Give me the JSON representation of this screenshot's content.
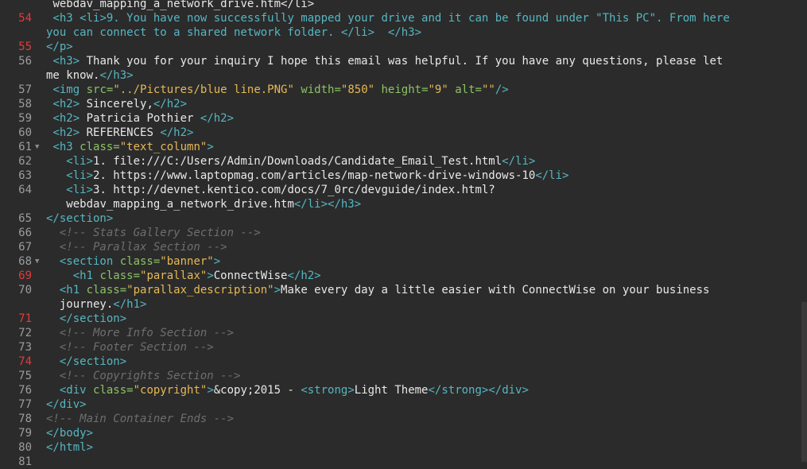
{
  "editor": {
    "lines": [
      {
        "num": "",
        "indent": 1,
        "fold": false,
        "err": false,
        "tokens": [
          {
            "t": "text",
            "v": "webdav_mapping_a_network_drive.htm</li>"
          }
        ]
      },
      {
        "num": "54",
        "indent": 1,
        "fold": false,
        "err": true,
        "tokens": [
          {
            "t": "tag",
            "v": "<h3 <li>"
          },
          {
            "t": "tag",
            "v": "9. You have now successfully mapped your drive and it can be found under \"This PC\". From here"
          }
        ]
      },
      {
        "num": "",
        "indent": 0,
        "fold": false,
        "err": false,
        "tokens": [
          {
            "t": "tag",
            "v": "you can connect to a shared network folder. </li>  </h3>"
          }
        ]
      },
      {
        "num": "55",
        "indent": 0,
        "fold": false,
        "err": true,
        "tokens": [
          {
            "t": "tag",
            "v": "</p>"
          }
        ]
      },
      {
        "num": "56",
        "indent": 1,
        "fold": false,
        "err": false,
        "tokens": [
          {
            "t": "tag",
            "v": "<h3>"
          },
          {
            "t": "text",
            "v": " Thank you for your inquiry I hope this email was helpful. If you have any questions, please let"
          }
        ]
      },
      {
        "num": "",
        "indent": 0,
        "fold": false,
        "err": false,
        "tokens": [
          {
            "t": "text",
            "v": "me know."
          },
          {
            "t": "tag",
            "v": "</h3>"
          }
        ]
      },
      {
        "num": "57",
        "indent": 1,
        "fold": false,
        "err": false,
        "tokens": [
          {
            "t": "tag",
            "v": "<img "
          },
          {
            "t": "attr",
            "v": "src="
          },
          {
            "t": "val",
            "v": "\"../Pictures/blue line.PNG\""
          },
          {
            "t": "attr",
            "v": " width="
          },
          {
            "t": "val",
            "v": "\"850\""
          },
          {
            "t": "attr",
            "v": " height="
          },
          {
            "t": "val",
            "v": "\"9\""
          },
          {
            "t": "attr",
            "v": " alt="
          },
          {
            "t": "val",
            "v": "\"\""
          },
          {
            "t": "tag",
            "v": "/>"
          }
        ]
      },
      {
        "num": "58",
        "indent": 1,
        "fold": false,
        "err": false,
        "tokens": [
          {
            "t": "tag",
            "v": "<h2>"
          },
          {
            "t": "text",
            "v": " Sincerely,"
          },
          {
            "t": "tag",
            "v": "</h2>"
          }
        ]
      },
      {
        "num": "59",
        "indent": 1,
        "fold": false,
        "err": false,
        "tokens": [
          {
            "t": "tag",
            "v": "<h2>"
          },
          {
            "t": "text",
            "v": " Patricia Pothier "
          },
          {
            "t": "tag",
            "v": "</h2>"
          }
        ]
      },
      {
        "num": "60",
        "indent": 1,
        "fold": false,
        "err": false,
        "tokens": [
          {
            "t": "tag",
            "v": "<h2>"
          },
          {
            "t": "text",
            "v": " REFERENCES "
          },
          {
            "t": "tag",
            "v": "</h2>"
          }
        ]
      },
      {
        "num": "61",
        "indent": 1,
        "fold": true,
        "err": false,
        "tokens": [
          {
            "t": "tag",
            "v": "<h3 "
          },
          {
            "t": "attr",
            "v": "class="
          },
          {
            "t": "val",
            "v": "\"text_column\""
          },
          {
            "t": "tag",
            "v": ">"
          }
        ]
      },
      {
        "num": "62",
        "indent": 3,
        "fold": false,
        "err": false,
        "tokens": [
          {
            "t": "tag",
            "v": "<li>"
          },
          {
            "t": "text",
            "v": "1. file:///C:/Users/Admin/Downloads/Candidate_Email_Test.html"
          },
          {
            "t": "tag",
            "v": "</li>"
          }
        ]
      },
      {
        "num": "63",
        "indent": 3,
        "fold": false,
        "err": false,
        "tokens": [
          {
            "t": "tag",
            "v": "<li>"
          },
          {
            "t": "text",
            "v": "2. https://www.laptopmag.com/articles/map-network-drive-windows-10"
          },
          {
            "t": "tag",
            "v": "</li>"
          }
        ]
      },
      {
        "num": "64",
        "indent": 3,
        "fold": false,
        "err": false,
        "tokens": [
          {
            "t": "tag",
            "v": "<li>"
          },
          {
            "t": "text",
            "v": "3. http://devnet.kentico.com/docs/7_0rc/devguide/index.html?"
          }
        ]
      },
      {
        "num": "",
        "indent": 3,
        "fold": false,
        "err": false,
        "tokens": [
          {
            "t": "text",
            "v": "webdav_mapping_a_network_drive.htm"
          },
          {
            "t": "tag",
            "v": "</li></h3>"
          }
        ]
      },
      {
        "num": "65",
        "indent": 0,
        "fold": false,
        "err": false,
        "tokens": [
          {
            "t": "tag",
            "v": "</section>"
          }
        ]
      },
      {
        "num": "66",
        "indent": 2,
        "fold": false,
        "err": false,
        "tokens": [
          {
            "t": "com",
            "v": "<!-- Stats Gallery Section -->"
          }
        ]
      },
      {
        "num": "67",
        "indent": 2,
        "fold": false,
        "err": false,
        "tokens": [
          {
            "t": "com",
            "v": "<!-- Parallax Section -->"
          }
        ]
      },
      {
        "num": "68",
        "indent": 2,
        "fold": true,
        "err": false,
        "tokens": [
          {
            "t": "tag",
            "v": "<section "
          },
          {
            "t": "attr",
            "v": "class="
          },
          {
            "t": "val",
            "v": "\"banner\""
          },
          {
            "t": "tag",
            "v": ">"
          }
        ]
      },
      {
        "num": "69",
        "indent": 4,
        "fold": false,
        "err": true,
        "tokens": [
          {
            "t": "tag",
            "v": "<h1 "
          },
          {
            "t": "attr",
            "v": "class="
          },
          {
            "t": "val",
            "v": "\"parallax\""
          },
          {
            "t": "tag",
            "v": ">"
          },
          {
            "t": "text",
            "v": "ConnectWise"
          },
          {
            "t": "tag",
            "v": "</h2>"
          }
        ]
      },
      {
        "num": "70",
        "indent": 2,
        "fold": false,
        "err": false,
        "tokens": [
          {
            "t": "tag",
            "v": "<h1 "
          },
          {
            "t": "attr",
            "v": "class="
          },
          {
            "t": "val",
            "v": "\"parallax_description\""
          },
          {
            "t": "tag",
            "v": ">"
          },
          {
            "t": "text",
            "v": "Make every day a little easier with ConnectWise on your business"
          }
        ]
      },
      {
        "num": "",
        "indent": 2,
        "fold": false,
        "err": false,
        "tokens": [
          {
            "t": "text",
            "v": "journey."
          },
          {
            "t": "tag",
            "v": "</h1>"
          }
        ]
      },
      {
        "num": "71",
        "indent": 2,
        "fold": false,
        "err": true,
        "tokens": [
          {
            "t": "tag",
            "v": "</section>"
          }
        ]
      },
      {
        "num": "72",
        "indent": 2,
        "fold": false,
        "err": false,
        "tokens": [
          {
            "t": "com",
            "v": "<!-- More Info Section -->"
          }
        ]
      },
      {
        "num": "73",
        "indent": 2,
        "fold": false,
        "err": false,
        "tokens": [
          {
            "t": "com",
            "v": "<!-- Footer Section -->"
          }
        ]
      },
      {
        "num": "74",
        "indent": 2,
        "fold": false,
        "err": true,
        "tokens": [
          {
            "t": "tag",
            "v": "</section>"
          }
        ]
      },
      {
        "num": "75",
        "indent": 2,
        "fold": false,
        "err": false,
        "tokens": [
          {
            "t": "com",
            "v": "<!-- Copyrights Section -->"
          }
        ]
      },
      {
        "num": "76",
        "indent": 2,
        "fold": false,
        "err": false,
        "tokens": [
          {
            "t": "tag",
            "v": "<div "
          },
          {
            "t": "attr",
            "v": "class="
          },
          {
            "t": "val",
            "v": "\"copyright\""
          },
          {
            "t": "tag",
            "v": ">"
          },
          {
            "t": "text",
            "v": "&copy;2015 - "
          },
          {
            "t": "tag",
            "v": "<strong>"
          },
          {
            "t": "text",
            "v": "Light Theme"
          },
          {
            "t": "tag",
            "v": "</strong></div>"
          }
        ]
      },
      {
        "num": "77",
        "indent": 0,
        "fold": false,
        "err": false,
        "tokens": [
          {
            "t": "tag",
            "v": "</div>"
          }
        ]
      },
      {
        "num": "78",
        "indent": 0,
        "fold": false,
        "err": false,
        "tokens": [
          {
            "t": "com",
            "v": "<!-- Main Container Ends -->"
          }
        ]
      },
      {
        "num": "79",
        "indent": 0,
        "fold": false,
        "err": false,
        "tokens": [
          {
            "t": "tag",
            "v": "</body>"
          }
        ]
      },
      {
        "num": "80",
        "indent": 0,
        "fold": false,
        "err": false,
        "tokens": [
          {
            "t": "tag",
            "v": "</html>"
          }
        ]
      },
      {
        "num": "81",
        "indent": 0,
        "fold": false,
        "err": false,
        "tokens": []
      }
    ],
    "fold_icon": "fold-triangle-icon"
  },
  "colors": {
    "background": "#2b2b2b",
    "tag": "#56b6c2",
    "attribute": "#8cc265",
    "value": "#e6b855",
    "text": "#e8e8e8",
    "comment": "#6e6e6e",
    "line_number": "#9c9c9c",
    "error_line_number": "#e03c3c"
  }
}
